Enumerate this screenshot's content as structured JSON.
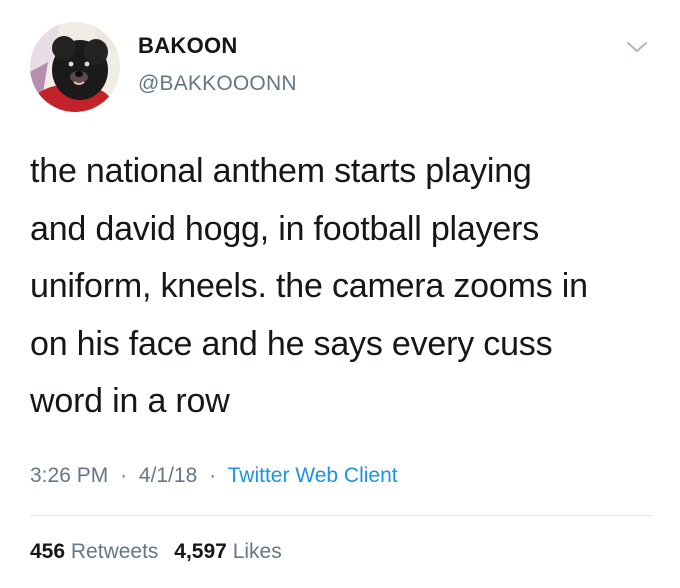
{
  "user": {
    "display_name": "BAKOON",
    "handle": "@BAKKOOONN"
  },
  "tweet": {
    "lines": [
      "the national anthem starts playing",
      "and david hogg, in football players",
      "uniform, kneels. the camera zooms in",
      "on his face and he says every cuss",
      "word in a row"
    ]
  },
  "meta": {
    "time": "3:26 PM",
    "separator": "·",
    "date": "4/1/18",
    "client": "Twitter Web Client"
  },
  "stats": {
    "retweets_count": "456",
    "retweets_label": "Retweets",
    "likes_count": "4,597",
    "likes_label": "Likes"
  },
  "icons": {
    "caret": "chevron-down-icon"
  },
  "colors": {
    "text": "#14171a",
    "muted": "#657786",
    "link": "#1b95e0",
    "divider": "#e1e8ed"
  }
}
